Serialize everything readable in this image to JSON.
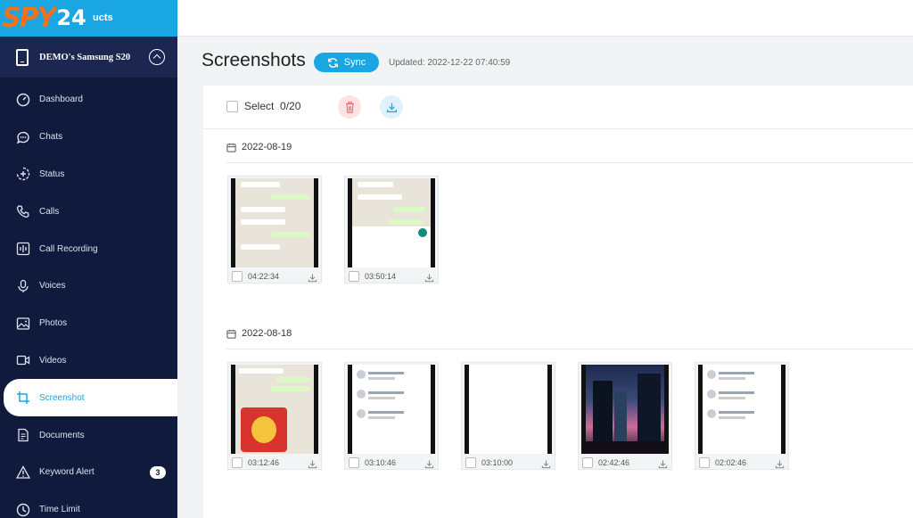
{
  "sidebar": {
    "logo_spy": "SPY",
    "logo_24": "24",
    "products_label": "ucts",
    "device_name": "DEMO's Samsung S20",
    "menu": [
      {
        "label": "Dashboard",
        "icon": "dashboard-icon"
      },
      {
        "label": "Chats",
        "icon": "chat-icon"
      },
      {
        "label": "Status",
        "icon": "status-icon"
      },
      {
        "label": "Calls",
        "icon": "phone-icon"
      },
      {
        "label": "Call Recording",
        "icon": "call-recording-icon"
      },
      {
        "label": "Voices",
        "icon": "microphone-icon"
      },
      {
        "label": "Photos",
        "icon": "photo-icon"
      },
      {
        "label": "Videos",
        "icon": "video-icon"
      },
      {
        "label": "Screenshot",
        "icon": "crop-icon"
      },
      {
        "label": "Documents",
        "icon": "document-icon"
      },
      {
        "label": "Keyword Alert",
        "icon": "alert-icon",
        "badge": "3"
      },
      {
        "label": "Time Limit",
        "icon": "clock-icon"
      }
    ],
    "active_index": 8
  },
  "header": {
    "title": "Screenshots",
    "sync_label": "Sync",
    "updated": "Updated: 2022-12-22 07:40:59"
  },
  "toolbar": {
    "select_label": "Select  0/20"
  },
  "groups": [
    {
      "date": "2022-08-19",
      "items": [
        {
          "time": "04:22:34",
          "kind": "chat-voice"
        },
        {
          "time": "03:50:14",
          "kind": "chat-emoji"
        }
      ]
    },
    {
      "date": "2022-08-18",
      "items": [
        {
          "time": "03:12:46",
          "kind": "chat-sticker"
        },
        {
          "time": "03:10:46",
          "kind": "chat-list"
        },
        {
          "time": "03:10:00",
          "kind": "blank"
        },
        {
          "time": "02:42:46",
          "kind": "city-night"
        },
        {
          "time": "02:02:46",
          "kind": "call-list"
        }
      ]
    }
  ],
  "colors": {
    "sidebar_bg": "#0f1a3c",
    "accent": "#1aa6e3",
    "logo_orange": "#f3701d",
    "delete_bg": "#fde2e4",
    "download_bg": "#dff1fb"
  }
}
